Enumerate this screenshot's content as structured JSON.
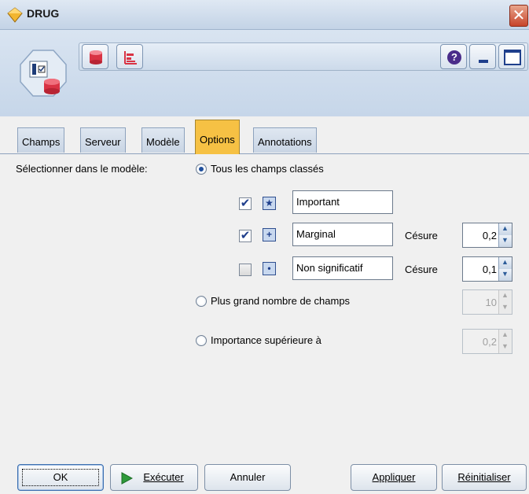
{
  "window": {
    "title": "DRUG",
    "close_glyph": "✕"
  },
  "toolbar": {
    "icons": [
      "database-icon",
      "chart-icon",
      "help-icon",
      "minimize-icon",
      "maximize-icon"
    ],
    "help_glyph": "?"
  },
  "tabs": [
    {
      "label": "Champs",
      "active": false
    },
    {
      "label": "Serveur",
      "active": false
    },
    {
      "label": "Modèle",
      "active": false
    },
    {
      "label": "Options",
      "active": true
    },
    {
      "label": "Annotations",
      "active": false
    }
  ],
  "options": {
    "select_label": "Sélectionner dans le modèle:",
    "radio_all": "Tous les champs classés",
    "rows": [
      {
        "checked": true,
        "symbol": "★",
        "value": "Important",
        "cutoff_label": "",
        "cutoff": ""
      },
      {
        "checked": true,
        "symbol": "+",
        "value": "Marginal",
        "cutoff_label": "Césure",
        "cutoff": "0,2"
      },
      {
        "checked": false,
        "symbol": "•",
        "value": "Non significatif",
        "cutoff_label": "Césure",
        "cutoff": "0,1"
      }
    ],
    "check_glyph": "✔",
    "radio_top_n": "Plus grand nombre de champs",
    "top_n_value": "10",
    "radio_importance": "Importance supérieure à",
    "importance_value": "0,2"
  },
  "buttons": {
    "ok": "OK",
    "execute": "Exécuter",
    "cancel": "Annuler",
    "apply": "Appliquer",
    "reset": "Réinitialiser"
  },
  "colors": {
    "active_tab": "#f6c144",
    "execute_arrow": "#2e9a3a"
  }
}
